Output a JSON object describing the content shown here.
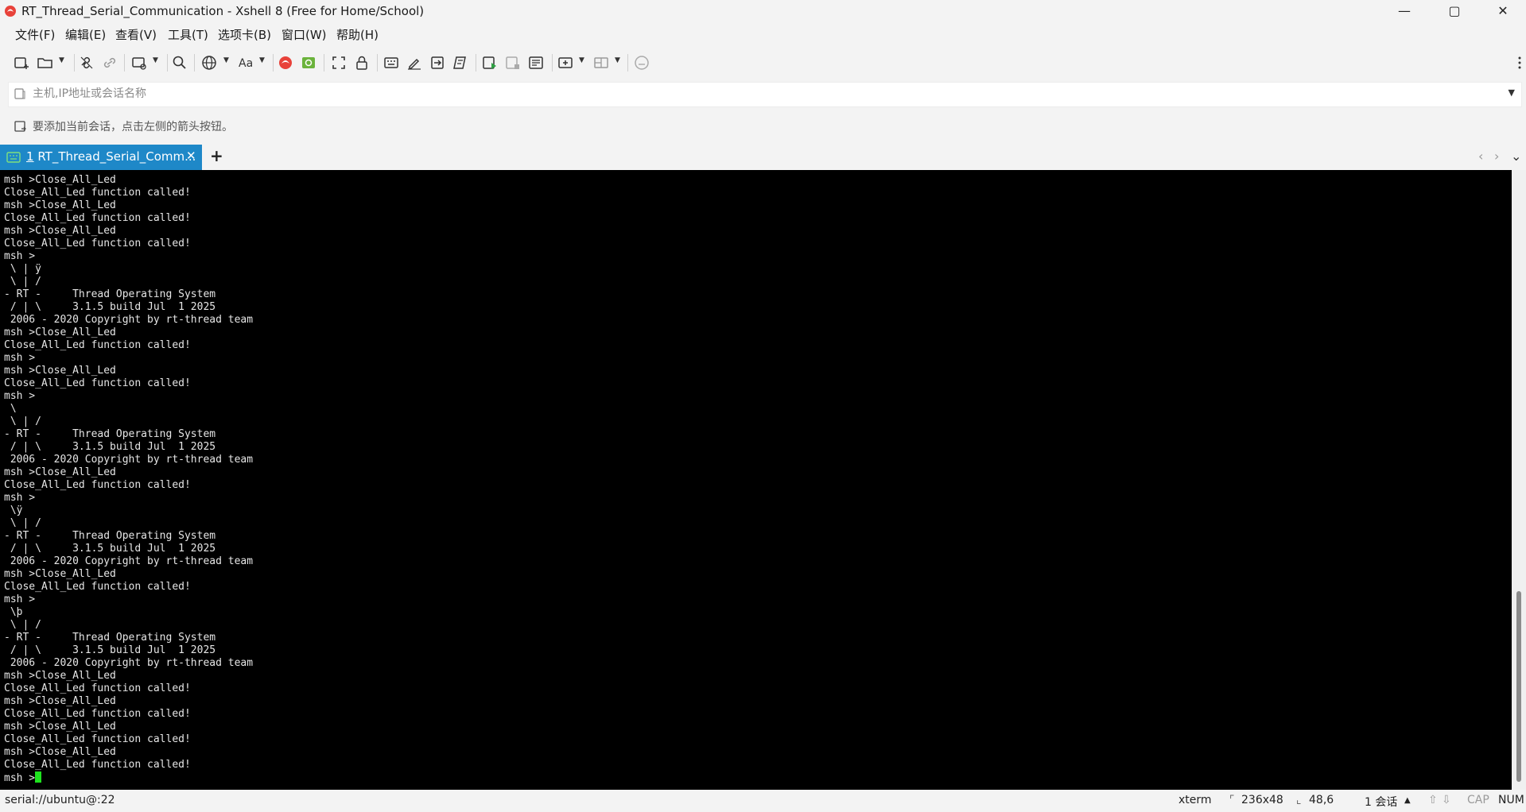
{
  "window": {
    "title": "RT_Thread_Serial_Communication - Xshell 8 (Free for Home/School)",
    "icon": "xshell-logo-icon",
    "controls": {
      "minimize": "—",
      "maximize": "▢",
      "close": "✕"
    }
  },
  "menu": [
    {
      "label": "文件(F)"
    },
    {
      "label": "编辑(E)"
    },
    {
      "label": "查看(V)"
    },
    {
      "label": "工具(T)"
    },
    {
      "label": "选项卡(B)"
    },
    {
      "label": "窗口(W)"
    },
    {
      "label": "帮助(H)"
    }
  ],
  "address_bar": {
    "placeholder": "主机,IP地址或会话名称",
    "value": ""
  },
  "hint": {
    "text": "要添加当前会话，点击左侧的箭头按钮。"
  },
  "tabs": [
    {
      "number": "1",
      "label": "RT_Thread_Serial_Comm...",
      "active": true,
      "close": "✕"
    }
  ],
  "tab_controls": {
    "add": "+",
    "prev": "‹",
    "next": "›",
    "list": "⌄"
  },
  "terminal": {
    "lines": [
      "msh >Close_All_Led",
      "Close_All_Led function called!",
      "msh >Close_All_Led",
      "Close_All_Led function called!",
      "msh >Close_All_Led",
      "Close_All_Led function called!",
      "msh >",
      " \\ | ÿ",
      " \\ | /",
      "- RT -     Thread Operating System",
      " / | \\     3.1.5 build Jul  1 2025",
      " 2006 - 2020 Copyright by rt-thread team",
      "msh >Close_All_Led",
      "Close_All_Led function called!",
      "msh >",
      "msh >Close_All_Led",
      "Close_All_Led function called!",
      "msh >",
      " \\",
      " \\ | /",
      "- RT -     Thread Operating System",
      " / | \\     3.1.5 build Jul  1 2025",
      " 2006 - 2020 Copyright by rt-thread team",
      "msh >Close_All_Led",
      "Close_All_Led function called!",
      "msh >",
      " \\ÿ",
      " \\ | /",
      "- RT -     Thread Operating System",
      " / | \\     3.1.5 build Jul  1 2025",
      " 2006 - 2020 Copyright by rt-thread team",
      "msh >Close_All_Led",
      "Close_All_Led function called!",
      "msh >",
      " \\þ",
      " \\ | /",
      "- RT -     Thread Operating System",
      " / | \\     3.1.5 build Jul  1 2025",
      " 2006 - 2020 Copyright by rt-thread team",
      "msh >Close_All_Led",
      "Close_All_Led function called!",
      "msh >Close_All_Led",
      "Close_All_Led function called!",
      "msh >Close_All_Led",
      "Close_All_Led function called!",
      "msh >Close_All_Led",
      "Close_All_Led function called!"
    ],
    "prompt": "msh >",
    "cursor_color": "#1ee21e"
  },
  "status": {
    "connection": "serial://ubuntu@:22",
    "terminal_type": "xterm",
    "size": "236x48",
    "cursor_pos": "48,6",
    "sessions": "1 会话",
    "caps": "CAP",
    "num": "NUM"
  },
  "colors": {
    "tab_active": "#1e88c8",
    "terminal_bg": "#000000",
    "terminal_fg": "#e6e6e6",
    "chrome_bg": "#f3f3f3"
  }
}
